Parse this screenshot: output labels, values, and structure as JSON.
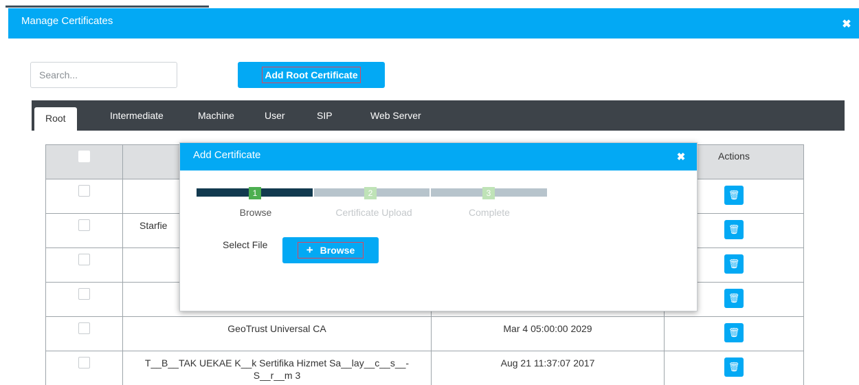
{
  "modal": {
    "title": "Manage Certificates",
    "close_icon": "close-icon"
  },
  "search": {
    "placeholder": "Search...",
    "value": ""
  },
  "add_root_label": "Add Root Certificate",
  "tabs": [
    {
      "label": "Root",
      "active": true
    },
    {
      "label": "Intermediate",
      "active": false
    },
    {
      "label": "Machine",
      "active": false
    },
    {
      "label": "User",
      "active": false
    },
    {
      "label": "SIP",
      "active": false
    },
    {
      "label": "Web Server",
      "active": false
    }
  ],
  "table": {
    "headers": {
      "select": "",
      "name": "",
      "expiry": "",
      "actions": "Actions"
    },
    "rows": [
      {
        "name": "",
        "expiry": ""
      },
      {
        "name": "Starfie",
        "expiry": ""
      },
      {
        "name": "",
        "expiry": ""
      },
      {
        "name": "",
        "expiry": ""
      },
      {
        "name": "GeoTrust Universal CA",
        "expiry": "Mar 4 05:00:00 2029"
      },
      {
        "name": "T__B__TAK UEKAE K__k Sertifika Hizmet Sa__lay__c__s__-\nS__r__m 3",
        "expiry": "Aug 21 11:37:07 2017"
      }
    ]
  },
  "dialog": {
    "title": "Add Certificate",
    "steps": [
      {
        "num": "1",
        "label": "Browse",
        "state": "current"
      },
      {
        "num": "2",
        "label": "Certificate Upload",
        "state": "pending"
      },
      {
        "num": "3",
        "label": "Complete",
        "state": "pending"
      }
    ],
    "select_file_label": "Select File",
    "browse_label": "Browse"
  },
  "colors": {
    "accent": "#03a9f4",
    "tabbar": "#3d4349",
    "step_done_bar": "#123a4f",
    "step_pending_bar": "#b7c4cc",
    "step_current": "#4caf50",
    "step_pending": "#bfe3b7",
    "highlight_border": "#e0455c"
  }
}
